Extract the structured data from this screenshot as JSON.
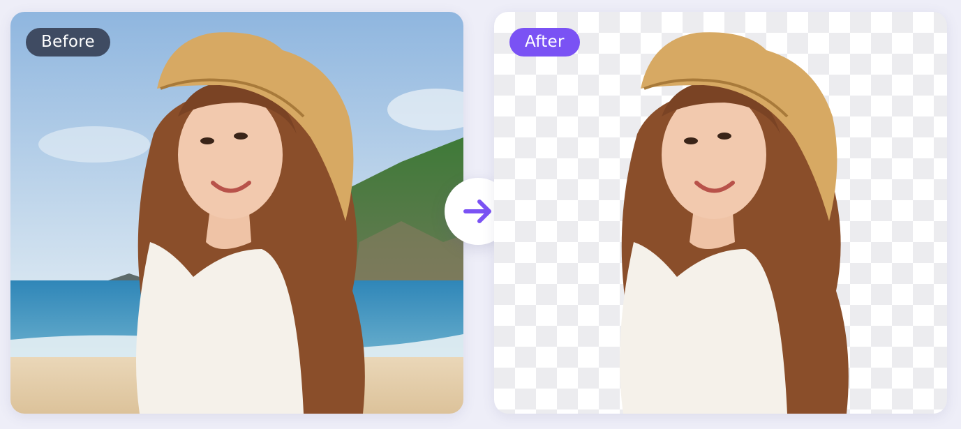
{
  "comparison": {
    "before": {
      "label": "Before",
      "image": "portrait-beach-background"
    },
    "after": {
      "label": "After",
      "image": "portrait-transparent-background"
    },
    "arrow_icon": "arrow-right-icon"
  },
  "colors": {
    "page_background": "#eeeef8",
    "before_pill": "#3f4b62",
    "after_pill": "#7a52f4",
    "arrow": "#7a52f4",
    "checker_light": "#ffffff",
    "checker_dark": "#ececef"
  }
}
